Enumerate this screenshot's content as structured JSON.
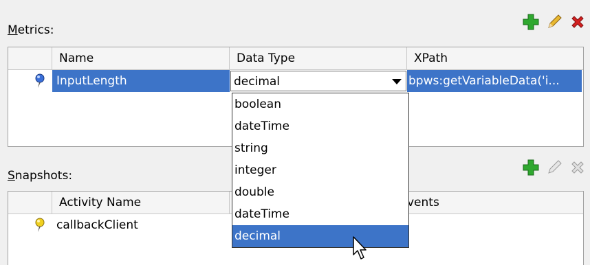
{
  "metrics": {
    "label_accel": "M",
    "label_rest": "etrics:",
    "columns": [
      "Name",
      "Data Type",
      "XPath"
    ],
    "row": {
      "name": "InputLength",
      "data_type": "decimal",
      "xpath": "bpws:getVariableData('i..."
    }
  },
  "snapshots": {
    "label_accel": "S",
    "label_rest": "napshots:",
    "columns": [
      "Activity Name",
      "",
      "vents"
    ],
    "row": {
      "activity_name": "callbackClient"
    }
  },
  "dropdown": {
    "options": [
      "boolean",
      "dateTime",
      "string",
      "integer",
      "double",
      "dateTime",
      "decimal"
    ],
    "highlighted": "decimal"
  },
  "colors": {
    "selection": "#3d74c8",
    "add": "#2fa82f",
    "remove": "#d42020",
    "edit": "#d9a020"
  },
  "icons": [
    "add-icon",
    "edit-icon",
    "remove-icon",
    "metric-pin-icon",
    "snapshot-pin-icon",
    "dropdown-arrow-icon",
    "mouse-cursor-icon"
  ]
}
